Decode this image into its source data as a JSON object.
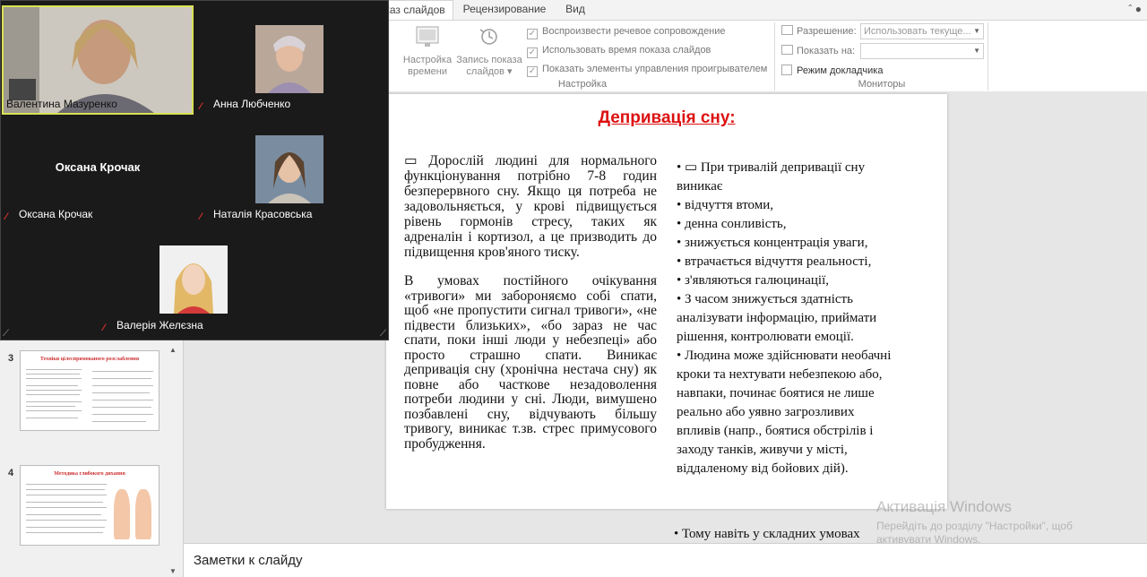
{
  "ribbon": {
    "tabs": [
      {
        "label": "каз слайдов"
      },
      {
        "label": "Рецензирование"
      },
      {
        "label": "Вид"
      }
    ],
    "buttons": {
      "rehearse": {
        "line1": "Настройка",
        "line2": "времени"
      },
      "record": {
        "line1": "Запись показа",
        "line2": "слайдов ▾"
      }
    },
    "checkboxes": [
      {
        "label": "Воспроизвести речевое сопровождение",
        "checked": true
      },
      {
        "label": "Использовать время показа слайдов",
        "checked": true
      },
      {
        "label": "Показать элементы управления проигрывателем",
        "checked": true
      }
    ],
    "check_mark": "✓",
    "group_setup": "Настройка",
    "monitors": {
      "resolution_label": "Разрешение:",
      "resolution_value": "Использовать текуще...",
      "show_on_label": "Показать на:",
      "show_on_value": "",
      "presenter_view_label": "Режим докладчика",
      "group_label": "Мониторы"
    },
    "window_controls": "ˆ ●"
  },
  "slide": {
    "title": "Депривація сну:",
    "left_p1": "Дорослій людині для нормального функціонування потрібно 7-8 годин безперервного сну. Якщо ця потреба не задовольняється, у крові підвищується рівень гормонів стресу, таких як адреналін і кортизол, а це призводить до підвищення кров'яного тиску.",
    "left_p1_icon": "▭",
    "left_p2": "В умовах постійного очікування «тривоги» ми забороняємо собі спати, щоб «не пропустити сигнал тривоги», «не підвести близьких», «бо зараз не час спати, поки інші люди у небезпеці» або просто страшно спати. Виникає депривація сну (хронічна нестача сну) як повне або часткове незадоволення потреби людини у сні. Люди, вимушено позбавлені сну, відчувають більшу тривогу, виникає т.зв. стрес примусового пробудження.",
    "right_lines": [
      "•    ▭    При тривалій депривації сну",
      "    виникає",
      " • відчуття втоми,",
      " • денна сонливість,",
      " • знижується концентрація уваги,",
      " • втрачається відчуття реальності,",
      "• з'являються галюцинації,",
      " • З часом знижується здатність",
      "аналізувати інформацію, приймати",
      "рішення, контролювати емоції.",
      " • Людина може здійснювати необачні",
      "кроки та нехтувати небезпекою або,",
      "навпаки, починає боятися не лише",
      "реально або уявно загрозливих",
      "впливів (напр., боятися обстрілів і",
      "заходу танків, живучи у місті,",
      "віддаленому від бойових дій)."
    ],
    "overflow_line": "•    Тому навіть у складних умовах"
  },
  "notes": {
    "placeholder": "Заметки к слайду"
  },
  "watermark": {
    "title": "Активація Windows",
    "subtitle1": "Перейдіть до розділу \"Настройки\", щоб",
    "subtitle2": "активувати Windows."
  },
  "thumbnails": [
    {
      "number": "3",
      "title": "Техніки цілеспрямованого розслаблення"
    },
    {
      "number": "4",
      "title": "Методика глибокого дихання"
    }
  ],
  "scroll": {
    "up": "▲",
    "down": "▼"
  },
  "video": {
    "participants": [
      {
        "name": "Валентина Мазуренко",
        "muted": false
      },
      {
        "name": "Анна Любченко",
        "muted": true
      },
      {
        "name": "Оксана Крочак",
        "muted": true,
        "display_name": "Оксана Крочак"
      },
      {
        "name": "Наталія Красовська",
        "muted": true
      },
      {
        "name": "Валерія Желєзна",
        "muted": true
      }
    ],
    "mute_glyph": "⁄",
    "resize_glyph": "⟋"
  }
}
